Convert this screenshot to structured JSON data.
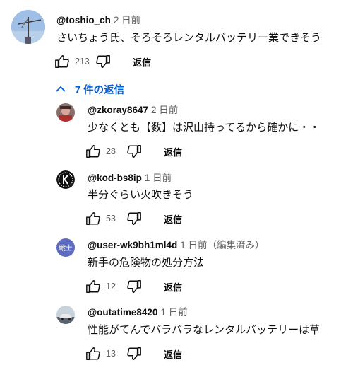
{
  "top_comment": {
    "author": "@toshio_ch",
    "time": "2 日前",
    "text": "さいちょう氏、そろそろレンタルバッテリー業できそう",
    "likes": "213",
    "reply_label": "返信"
  },
  "replies_toggle": {
    "label": "7 件の返信"
  },
  "replies": [
    {
      "author": "@zkoray8647",
      "time": "2 日前",
      "text": "少なくとも【数】は沢山持ってるから確かに・・",
      "likes": "28",
      "reply_label": "返信"
    },
    {
      "author": "@kod-bs8ip",
      "time": "1 日前",
      "text": "半分ぐらい火吹きそう",
      "likes": "53",
      "reply_label": "返信"
    },
    {
      "author": "@user-wk9bh1ml4d",
      "time": "1 日前（編集済み）",
      "text": "新手の危険物の処分方法",
      "likes": "12",
      "reply_label": "返信",
      "avatar_text": "戦士"
    },
    {
      "author": "@outatime8420",
      "time": "1 日前",
      "text": "性能がてんでバラバラなレンタルバッテリーは草",
      "likes": "13",
      "reply_label": "返信"
    }
  ],
  "colors": {
    "link_blue": "#065fd4",
    "avatar_purple": "#5c6bc0",
    "muted": "#606060"
  }
}
